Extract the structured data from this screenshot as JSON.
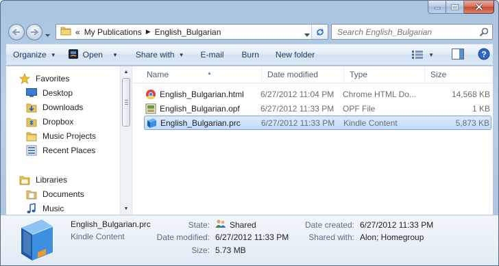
{
  "window": {
    "controls": [
      "minimize",
      "maximize",
      "close"
    ]
  },
  "address_bar": {
    "overflow": "«",
    "crumbs": [
      "My Publications",
      "English_Bulgarian"
    ]
  },
  "search": {
    "placeholder": "Search English_Bulgarian"
  },
  "toolbar": {
    "organize": "Organize",
    "open": "Open",
    "share_with": "Share with",
    "email": "E-mail",
    "burn": "Burn",
    "new_folder": "New folder"
  },
  "nav_pane": {
    "favorites_label": "Favorites",
    "favorites": [
      {
        "label": "Desktop",
        "icon": "desktop-icon"
      },
      {
        "label": "Downloads",
        "icon": "downloads-folder-icon"
      },
      {
        "label": "Dropbox",
        "icon": "dropbox-icon"
      },
      {
        "label": "Music Projects",
        "icon": "folder-icon"
      },
      {
        "label": "Recent Places",
        "icon": "recent-places-icon"
      }
    ],
    "libraries_label": "Libraries",
    "libraries": [
      {
        "label": "Documents",
        "icon": "documents-icon"
      },
      {
        "label": "Music",
        "icon": "music-icon"
      }
    ]
  },
  "columns": {
    "name": "Name",
    "date_modified": "Date modified",
    "type": "Type",
    "size": "Size"
  },
  "files": [
    {
      "name": "English_Bulgarian.html",
      "date": "6/27/2012 11:04 PM",
      "type": "Chrome HTML Do...",
      "size": "14,568 KB",
      "icon": "chrome-html-icon",
      "selected": false
    },
    {
      "name": "English_Bulgarian.opf",
      "date": "6/27/2012 11:33 PM",
      "type": "OPF File",
      "size": "1 KB",
      "icon": "opf-file-icon",
      "selected": false
    },
    {
      "name": "English_Bulgarian.prc",
      "date": "6/27/2012 11:33 PM",
      "type": "Kindle Content",
      "size": "5,873 KB",
      "icon": "kindle-book-icon",
      "selected": true
    }
  ],
  "details": {
    "file_name": "English_Bulgarian.prc",
    "file_type": "Kindle Content",
    "state_label": "State:",
    "state_value": "Shared",
    "date_modified_label": "Date modified:",
    "date_modified_value": "6/27/2012 11:33 PM",
    "size_label": "Size:",
    "size_value": "5.73 MB",
    "date_created_label": "Date created:",
    "date_created_value": "6/27/2012 11:33 PM",
    "shared_with_label": "Shared with:",
    "shared_with_value": "Alon; Homegroup"
  },
  "colors": {
    "frame": "#b9d1ea",
    "selection": "#c1dbfc",
    "command_text": "#1e395b"
  }
}
